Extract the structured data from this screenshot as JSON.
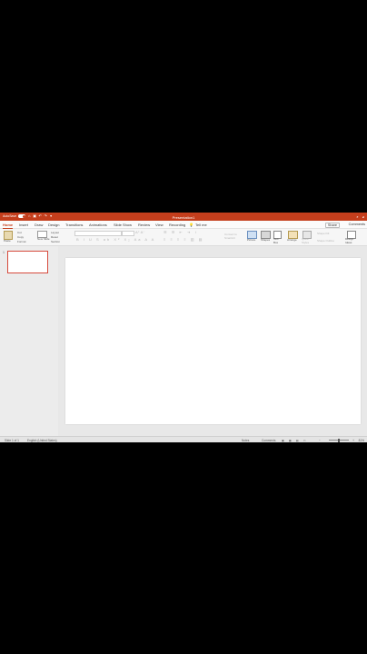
{
  "titlebar": {
    "autosave_label": "AutoSave",
    "autosave_state": "On",
    "document_title": "Presentation1"
  },
  "tabs": [
    {
      "label": "Home",
      "active": true
    },
    {
      "label": "Insert"
    },
    {
      "label": "Draw"
    },
    {
      "label": "Design"
    },
    {
      "label": "Transitions"
    },
    {
      "label": "Animations"
    },
    {
      "label": "Slide Show"
    },
    {
      "label": "Review"
    },
    {
      "label": "View"
    },
    {
      "label": "Recording"
    },
    {
      "label": "Tell me"
    }
  ],
  "share_label": "Share",
  "comments_label": "Comments",
  "ribbon": {
    "paste": "Paste",
    "cut": "Cut",
    "copy": "Copy",
    "format": "Format",
    "new_slide": "New Slide",
    "layout": "Layout",
    "reset": "Reset",
    "section": "Section",
    "picture": "Picture",
    "shapes": "Shapes",
    "text_box": "Text Box",
    "arrange": "Arrange",
    "quick_styles": "Quick Styles",
    "shape_fill": "Shape Fill",
    "shape_outline": "Shape Outline",
    "convert": "Convert to SmartArt",
    "design_ideas": "Design Ideas"
  },
  "slide_number": "1",
  "status": {
    "slide_count": "Slide 1 of 1",
    "language": "English (United States)",
    "notes": "Notes",
    "comments": "Comments",
    "zoom": "81%"
  },
  "colors": {
    "accent": "#c43e1c"
  }
}
